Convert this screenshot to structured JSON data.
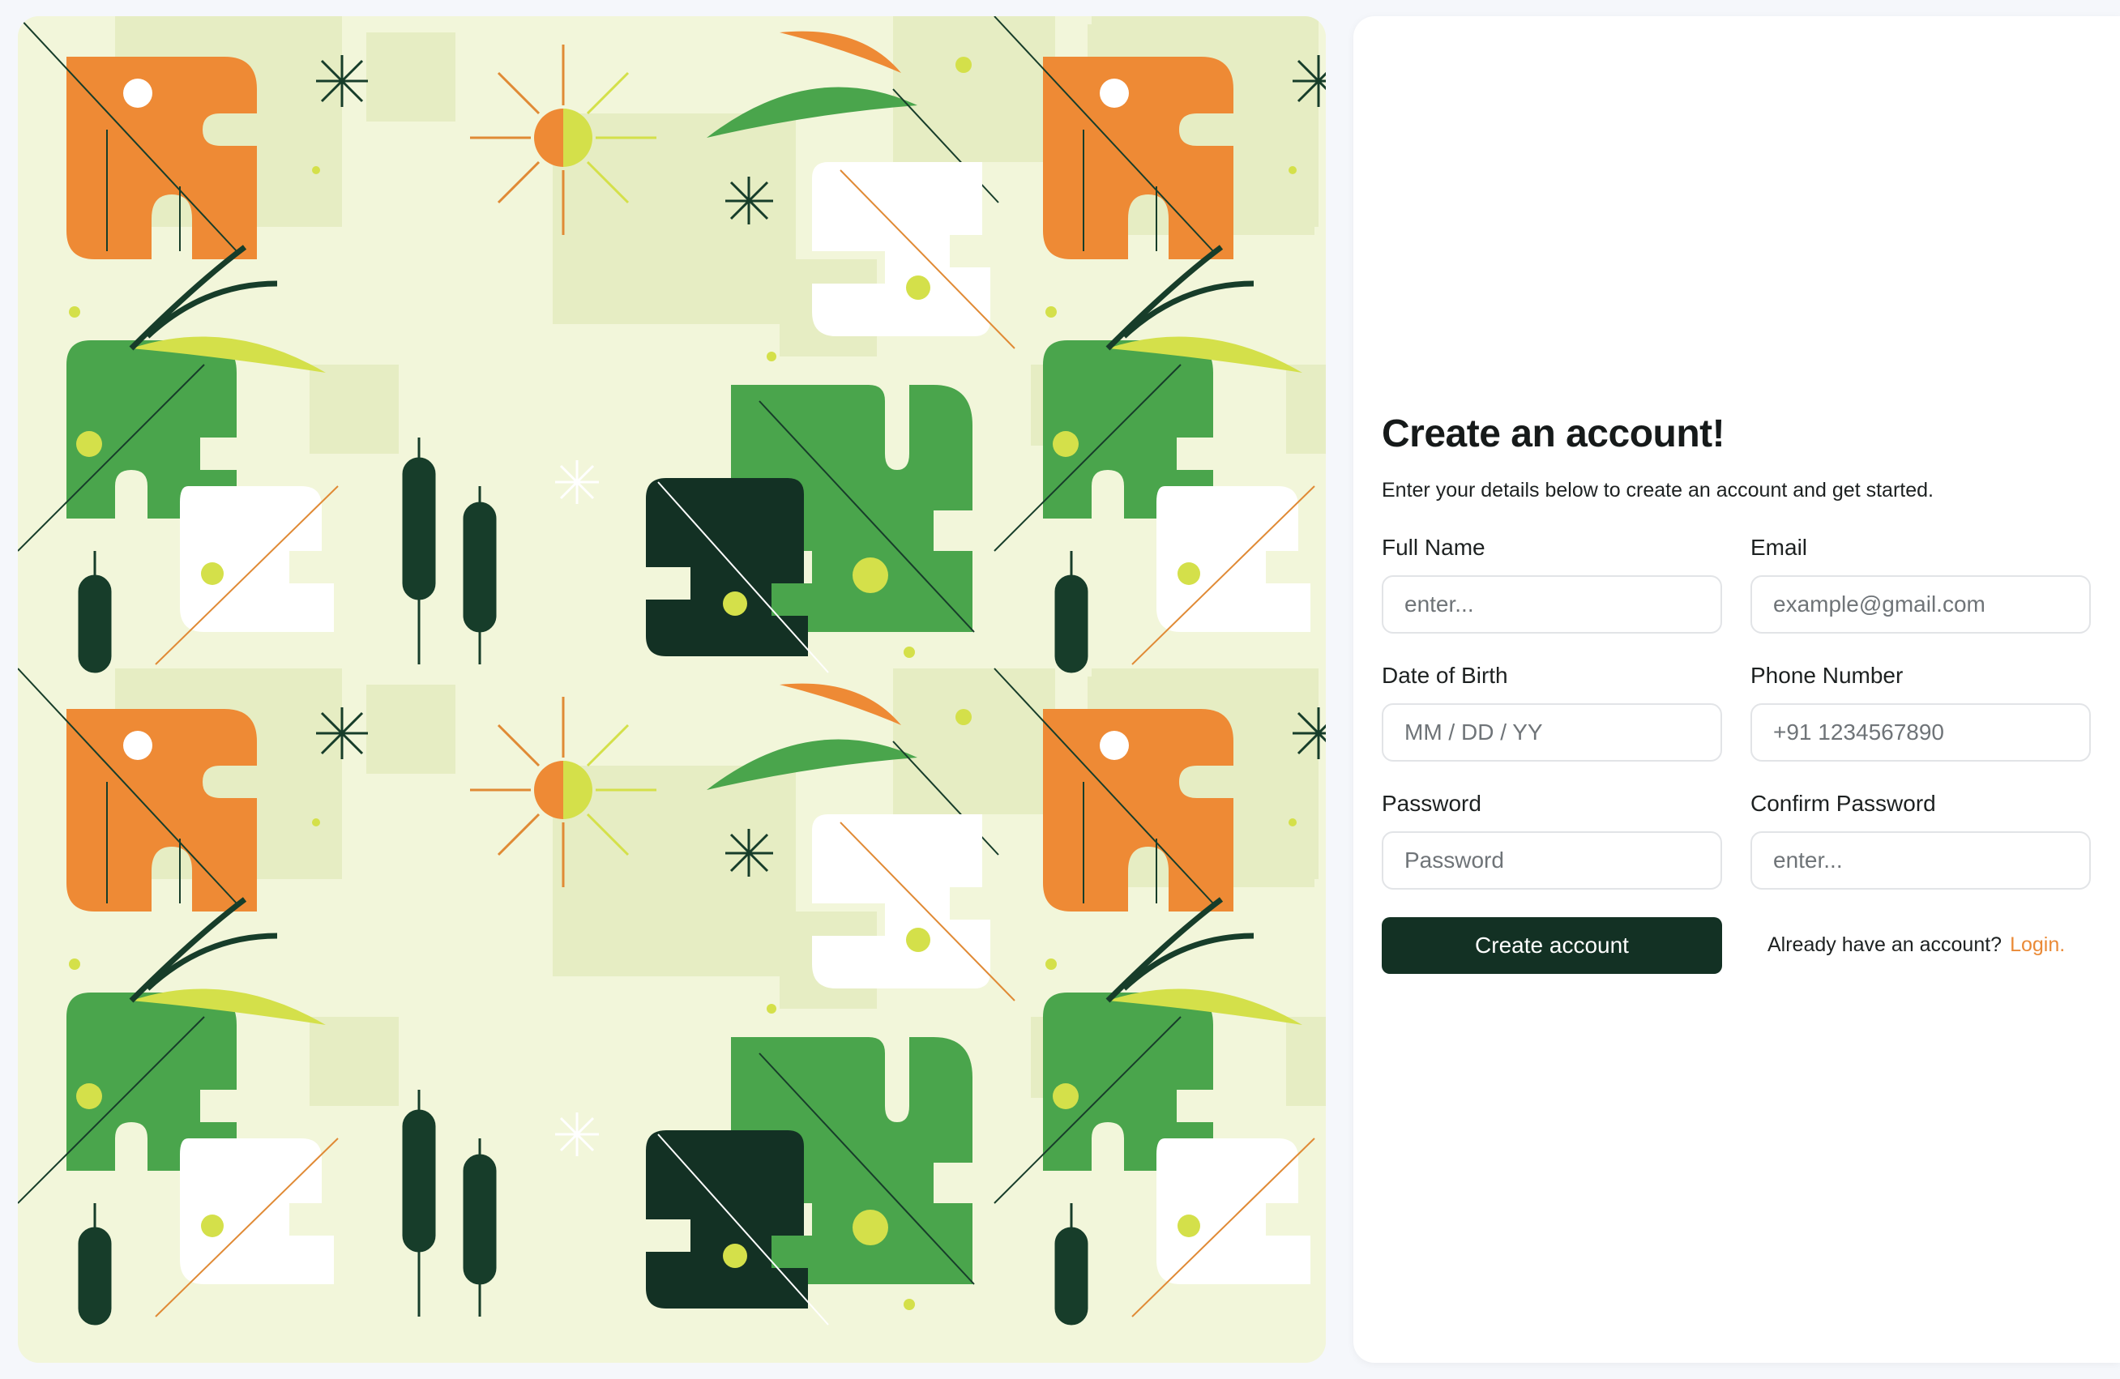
{
  "signup": {
    "title": "Create an account!",
    "subtitle": "Enter your details below to create an account and get started.",
    "fields": {
      "full_name": {
        "label": "Full Name",
        "placeholder": "enter..."
      },
      "email": {
        "label": "Email",
        "placeholder": "example@gmail.com"
      },
      "dob": {
        "label": "Date of Birth",
        "placeholder": "MM / DD / YY"
      },
      "phone": {
        "label": "Phone Number",
        "placeholder": "+91 1234567890"
      },
      "password": {
        "label": "Password",
        "placeholder": "Password"
      },
      "confirm_password": {
        "label": "Confirm Password",
        "placeholder": "enter..."
      }
    },
    "submit_label": "Create account",
    "login_prompt": "Already have an account?",
    "login_link": "Login."
  },
  "colors": {
    "accent_dark_green": "#133124",
    "accent_orange": "#ea8a37",
    "art_background": "#f2f6da",
    "leaf_green": "#4aa54c",
    "leaf_lime": "#d4e04a"
  },
  "illustration": {
    "icons": [
      "tropical-leaf-icon",
      "sun-icon",
      "cattail-icon",
      "sparkle-icon"
    ]
  }
}
